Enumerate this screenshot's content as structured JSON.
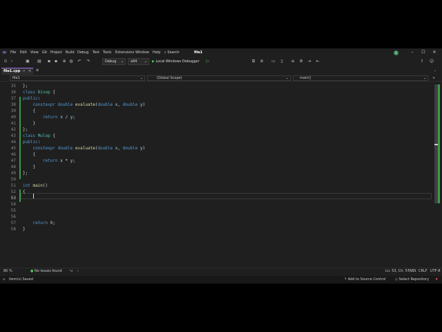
{
  "menubar": {
    "items": [
      "File",
      "Edit",
      "View",
      "Git",
      "Project",
      "Build",
      "Debug",
      "Test",
      "Tools",
      "Extensions",
      "Window",
      "Help"
    ],
    "search_label": "Search",
    "solution_name": "file1",
    "avatar_initial": "S"
  },
  "toolbar": {
    "configuration": "Debug",
    "platform": "x64",
    "run_label": "Local Windows Debugger"
  },
  "tabs": [
    {
      "label": "file1.cpp",
      "pin_icon": "pin-icon",
      "close_icon": "close-icon"
    }
  ],
  "navbar": {
    "project": "file1",
    "scope": "(Global Scope)",
    "member": "main()"
  },
  "editor": {
    "lines": [
      {
        "num": "35",
        "text": "};"
      },
      {
        "num": "36",
        "text": "class Divop {"
      },
      {
        "num": "37",
        "text": "public:"
      },
      {
        "num": "38",
        "text": "    constexpr double evaluate(double x, double y)"
      },
      {
        "num": "39",
        "text": "    {"
      },
      {
        "num": "40",
        "text": "        return x / y;"
      },
      {
        "num": "41",
        "text": "    }"
      },
      {
        "num": "42",
        "text": "};"
      },
      {
        "num": "43",
        "text": "class Mulop {"
      },
      {
        "num": "44",
        "text": "public:"
      },
      {
        "num": "45",
        "text": "    constexpr double evaluate(double x, double y)"
      },
      {
        "num": "46",
        "text": "    {"
      },
      {
        "num": "47",
        "text": "        return x * y;"
      },
      {
        "num": "48",
        "text": "    }"
      },
      {
        "num": "49",
        "text": "};"
      },
      {
        "num": "50",
        "text": ""
      },
      {
        "num": "51",
        "text": "int main()"
      },
      {
        "num": "52",
        "text": "{"
      },
      {
        "num": "53",
        "text": ""
      },
      {
        "num": "54",
        "text": ""
      },
      {
        "num": "55",
        "text": ""
      },
      {
        "num": "56",
        "text": ""
      },
      {
        "num": "57",
        "text": "    return 0;"
      },
      {
        "num": "58",
        "text": "}"
      }
    ],
    "current_line": "53"
  },
  "editor_status": {
    "zoom": "80 %",
    "issues": "No issues found",
    "position": "Ln: 53, Ch: 5",
    "indent": "TABS",
    "line_ending": "CRLF",
    "encoding": "UTF-8"
  },
  "statusbar": {
    "message": "Item(s) Saved",
    "source_control": "Add to Source Control",
    "repository": "Select Repository"
  },
  "colors": {
    "accent": "#a678e8",
    "ok": "#4ec94e",
    "modified": "#3c9b4a"
  }
}
